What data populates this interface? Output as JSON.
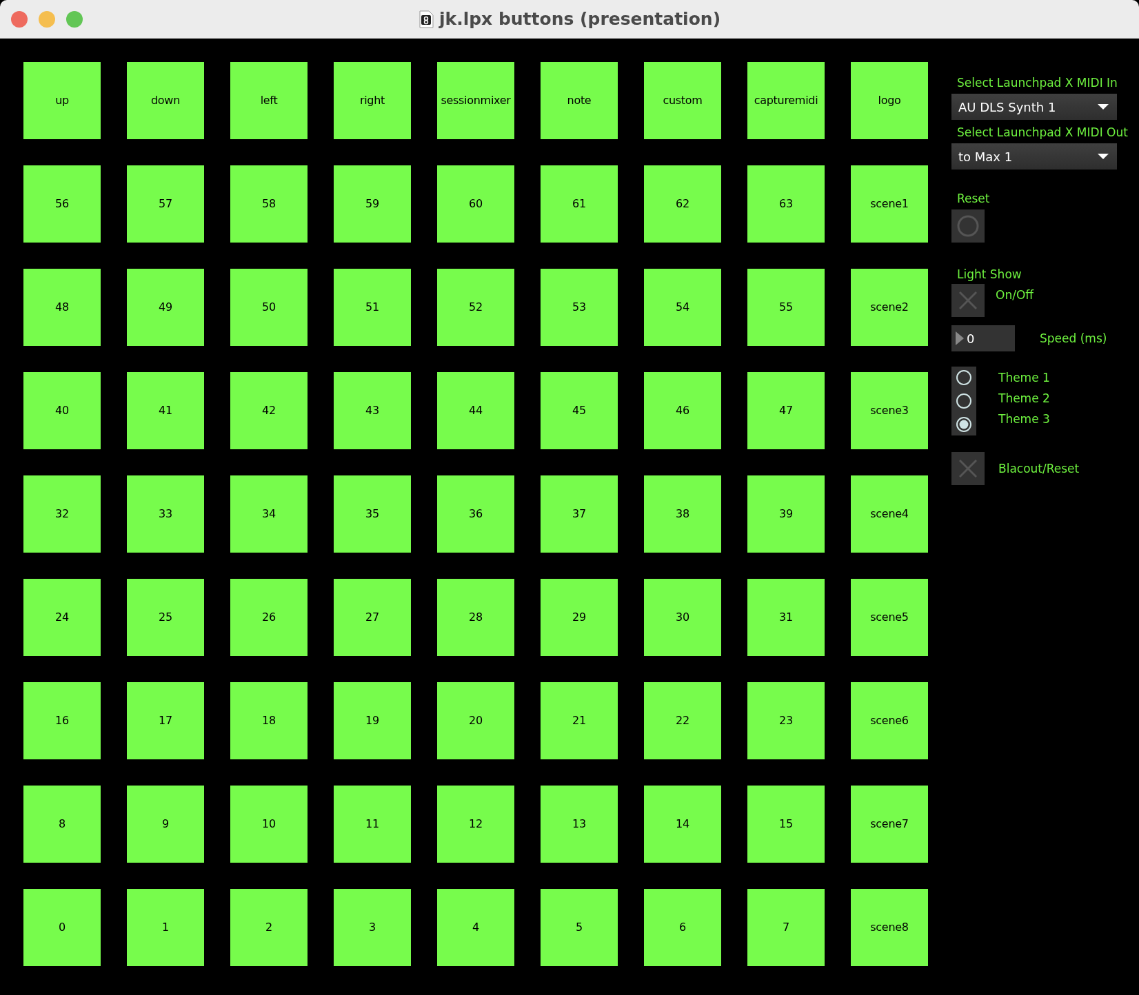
{
  "window": {
    "title": "jk.lpx buttons (presentation)"
  },
  "pads": [
    [
      "up",
      "down",
      "left",
      "right",
      "sessionmixer",
      "note",
      "custom",
      "capturemidi",
      "logo"
    ],
    [
      "56",
      "57",
      "58",
      "59",
      "60",
      "61",
      "62",
      "63",
      "scene1"
    ],
    [
      "48",
      "49",
      "50",
      "51",
      "52",
      "53",
      "54",
      "55",
      "scene2"
    ],
    [
      "40",
      "41",
      "42",
      "43",
      "44",
      "45",
      "46",
      "47",
      "scene3"
    ],
    [
      "32",
      "33",
      "34",
      "35",
      "36",
      "37",
      "38",
      "39",
      "scene4"
    ],
    [
      "24",
      "25",
      "26",
      "27",
      "28",
      "29",
      "30",
      "31",
      "scene5"
    ],
    [
      "16",
      "17",
      "18",
      "19",
      "20",
      "21",
      "22",
      "23",
      "scene6"
    ],
    [
      "8",
      "9",
      "10",
      "11",
      "12",
      "13",
      "14",
      "15",
      "scene7"
    ],
    [
      "0",
      "1",
      "2",
      "3",
      "4",
      "5",
      "6",
      "7",
      "scene8"
    ]
  ],
  "panel": {
    "midi_in": {
      "label": "Select Launchpad X MIDI In",
      "value": "AU DLS Synth 1"
    },
    "midi_out": {
      "label": "Select Launchpad X MIDI Out",
      "value": "to Max 1"
    },
    "reset": {
      "label": "Reset"
    },
    "light_show": {
      "label": "Light Show",
      "toggle_label": "On/Off",
      "checked": false
    },
    "speed": {
      "value": "0",
      "label": "Speed (ms)"
    },
    "themes": [
      {
        "label": "Theme 1",
        "selected": false
      },
      {
        "label": "Theme 2",
        "selected": false
      },
      {
        "label": "Theme 3",
        "selected": true
      }
    ],
    "blackout": {
      "label": "Blacout/Reset",
      "checked": false
    }
  }
}
